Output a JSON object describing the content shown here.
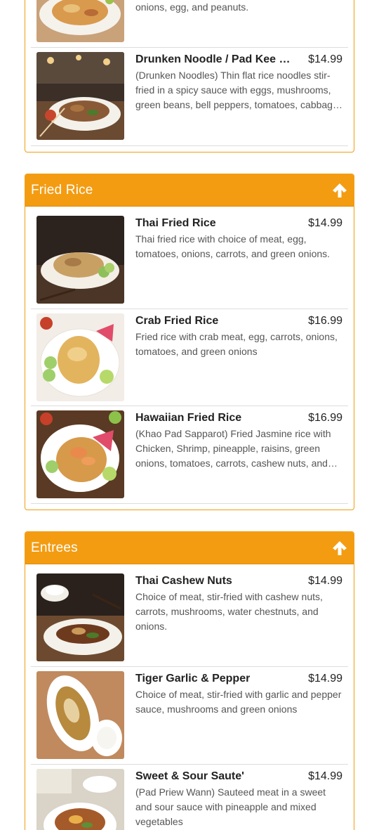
{
  "colors": {
    "accent": "#f39c12",
    "header_text": "#ffffff"
  },
  "top_section": {
    "partial_item": {
      "desc": "onions, egg, and peanuts."
    },
    "drunken": {
      "name": "Drunken Noodle / Pad Kee Mao",
      "price": "$14.99",
      "desc": "(Drunken Noodles) Thin flat rice noodles stir-fried in a spicy sauce with eggs, mushrooms, green beans, bell peppers, tomatoes, cabbage, onions and basil."
    }
  },
  "fried_rice": {
    "title": "Fried Rice",
    "icon": "arrow-up-icon",
    "items": [
      {
        "name": "Thai Fried Rice",
        "price": "$14.99",
        "desc": "Thai fried rice with choice of meat, egg, tomatoes, onions, carrots, and green onions."
      },
      {
        "name": "Crab Fried Rice",
        "price": "$16.99",
        "desc": "Fried rice with crab meat, egg, carrots, onions, tomatoes, and green onions"
      },
      {
        "name": "Hawaiian Fried Rice",
        "price": "$16.99",
        "desc": "(Khao Pad Sapparot) Fried Jasmine rice with Chicken, Shrimp, pineapple, raisins, green onions, tomatoes, carrots, cashew nuts, and curry powder."
      }
    ]
  },
  "entrees": {
    "title": "Entrees",
    "icon": "arrow-up-icon",
    "items": [
      {
        "name": "Thai Cashew Nuts",
        "price": "$14.99",
        "desc": "Choice of meat, stir-fried with cashew nuts, carrots, mushrooms, water chestnuts, and onions."
      },
      {
        "name": "Tiger Garlic & Pepper",
        "price": "$14.99",
        "desc": "Choice of meat, stir-fried with garlic and pepper sauce, mushrooms and green onions"
      },
      {
        "name": "Sweet & Sour Saute'",
        "price": "$14.99",
        "desc": "(Pad Priew Wann) Sauteed meat in a sweet and sour sauce with pineapple and mixed vegetables"
      }
    ]
  }
}
